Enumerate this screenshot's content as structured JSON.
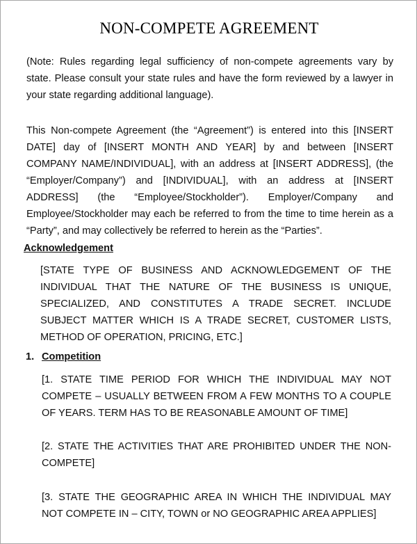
{
  "document": {
    "title": "NON-COMPETE AGREEMENT",
    "note": "(Note: Rules regarding legal sufficiency of non-compete agreements vary by state. Please consult your state rules and have the form reviewed by a lawyer in your state regarding additional language).",
    "intro": "This Non-compete Agreement (the “Agreement”) is entered into this [INSERT DATE] day of [INSERT MONTH AND YEAR] by and between [INSERT COMPANY NAME/INDIVIDUAL], with an address at [INSERT ADDRESS], (the “Employer/Company”) and [INDIVIDUAL], with an address at [INSERT ADDRESS] (the “Employee/Stockholder”). Employer/Company and Employee/Stockholder may each be referred to from the time to time herein as a “Party”, and may collectively be referred to herein as the “Parties”.",
    "acknowledgement": {
      "heading": "Acknowledgement",
      "body": "[STATE TYPE OF BUSINESS AND ACKNOWLEDGEMENT OF THE INDIVIDUAL THAT THE NATURE OF THE BUSINESS IS UNIQUE, SPECIALIZED, AND CONSTITUTES A TRADE SECRET. INCLUDE SUBJECT MATTER WHICH IS A TRADE SECRET, CUSTOMER LISTS, METHOD OF OPERATION, PRICING, ETC.]"
    },
    "competition": {
      "number": "1.",
      "heading": "Competition",
      "items": [
        "[1. STATE TIME PERIOD FOR WHICH THE INDIVIDUAL MAY NOT COMPETE – USUALLY BETWEEN FROM A FEW MONTHS TO A COUPLE OF YEARS. TERM HAS TO BE REASONABLE AMOUNT OF TIME]",
        "[2. STATE THE ACTIVITIES THAT ARE PROHIBITED UNDER THE NON-COMPETE]",
        "[3. STATE THE GEOGRAPHIC AREA IN WHICH THE INDIVIDUAL MAY NOT COMPETE IN – CITY, TOWN or NO GEOGRAPHIC AREA APPLIES]"
      ]
    }
  }
}
